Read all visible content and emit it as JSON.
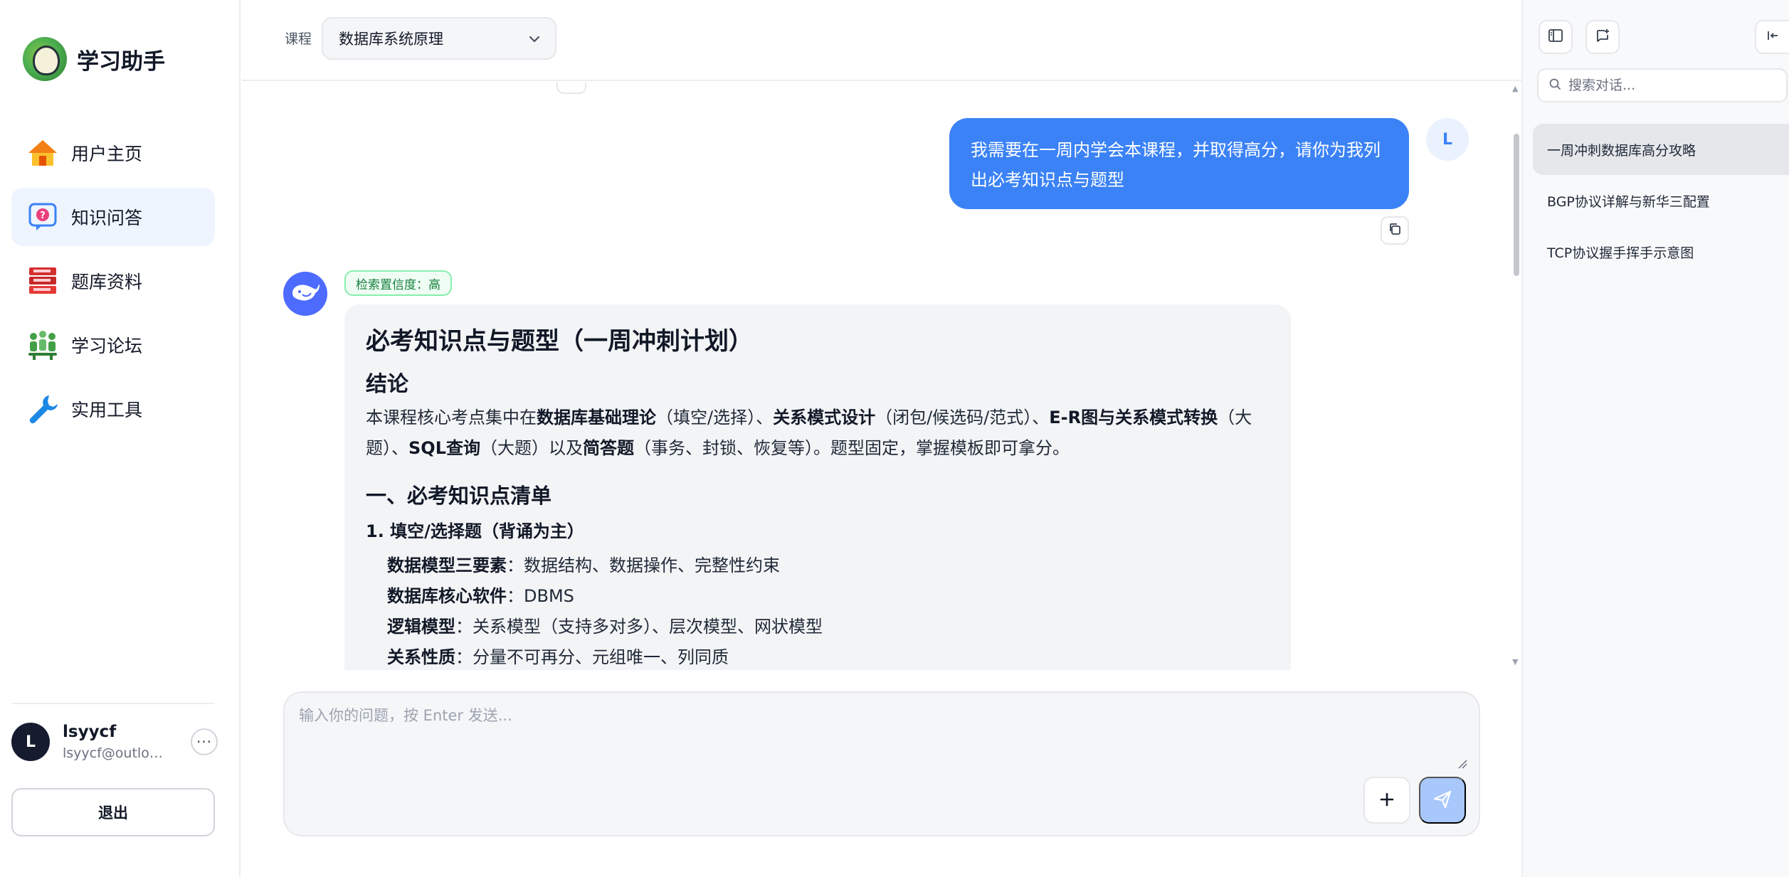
{
  "app": {
    "title": "学习助手"
  },
  "sidebar": {
    "items": [
      {
        "label": "用户主页",
        "icon": "home-icon"
      },
      {
        "label": "知识问答",
        "icon": "question-bubble-icon",
        "active": true
      },
      {
        "label": "题库资料",
        "icon": "book-stack-icon"
      },
      {
        "label": "学习论坛",
        "icon": "forum-people-icon"
      },
      {
        "label": "实用工具",
        "icon": "wrench-icon"
      }
    ],
    "user": {
      "avatar_letter": "L",
      "name": "lsyycf",
      "email": "lsyycf@outlook.com"
    },
    "more_label": "···",
    "logout_label": "退出"
  },
  "header": {
    "course_label": "课程",
    "course_value": "数据库系统原理"
  },
  "chat": {
    "user_message": "我需要在一周内学会本课程，并取得高分，请你为我列出必考知识点与题型",
    "user_avatar_letter": "L",
    "confidence_badge": "检索置信度：高",
    "answer": {
      "h1": "必考知识点与题型（一周冲刺计划）",
      "conclusion_title": "结论",
      "conclusion": {
        "t1": "本课程核心考点集中在",
        "b1": "数据库基础理论",
        "t2": "（填空/选择）、",
        "b2": "关系模式设计",
        "t3": "（闭包/候选码/范式）、",
        "b3": "E-R图与关系模式转换",
        "t4": "（大题）、",
        "b4": "SQL查询",
        "t5": "（大题）以及",
        "b5": "简答题",
        "t6": "（事务、封锁、恢复等）。题型固定，掌握模板即可拿分。"
      },
      "section1_title": "一、必考知识点清单",
      "sub1_title": "1. 填空/选择题（背诵为主）",
      "bullets": [
        {
          "term": "数据模型三要素",
          "desc": "：数据结构、数据操作、完整性约束"
        },
        {
          "term": "数据库核心软件",
          "desc": "：DBMS"
        },
        {
          "term": "逻辑模型",
          "desc": "：关系模型（支持多对多）、层次模型、网状模型"
        },
        {
          "term": "关系性质",
          "desc": "：分量不可再分、元组唯一、列同质"
        }
      ]
    }
  },
  "input": {
    "placeholder": "输入你的问题，按 Enter 发送...",
    "value": ""
  },
  "right_panel": {
    "search_placeholder": "搜索对话...",
    "conversations": [
      {
        "title": "一周冲刺数据库高分攻略",
        "active": true
      },
      {
        "title": "BGP协议详解与新华三配置"
      },
      {
        "title": "TCP协议握手挥手示意图"
      }
    ]
  },
  "colors": {
    "accent": "#3b82f6",
    "nav_active_bg": "#eef5ff",
    "badge_green": "#15803d",
    "send_disabled": "#a8c8fb"
  }
}
